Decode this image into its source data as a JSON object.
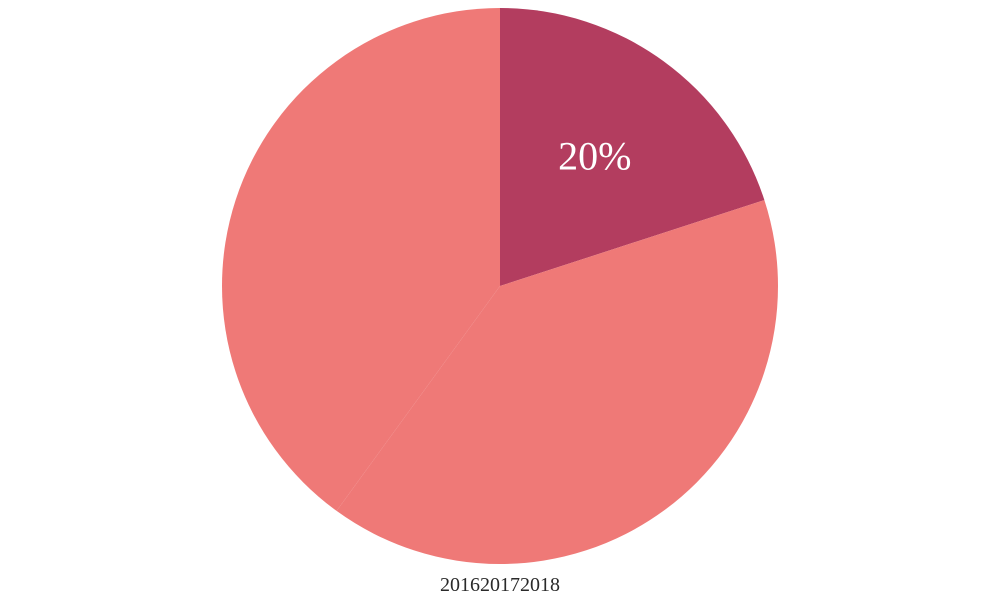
{
  "chart_data": {
    "type": "pie",
    "center": {
      "x": 500,
      "y": 286
    },
    "radius": 278,
    "background_color": "#ffffff",
    "series": [
      {
        "name": "2016",
        "value": 20,
        "percent_label": "20%",
        "show_label": true,
        "color": "#b33d5f"
      },
      {
        "name": "2017",
        "value": 40,
        "percent_label": "",
        "show_label": false,
        "color": "#ef7977"
      },
      {
        "name": "2018",
        "value": 40,
        "percent_label": "",
        "show_label": false,
        "color": "#ef7977"
      }
    ],
    "legend": [
      "2016",
      "2017",
      "2018"
    ]
  }
}
